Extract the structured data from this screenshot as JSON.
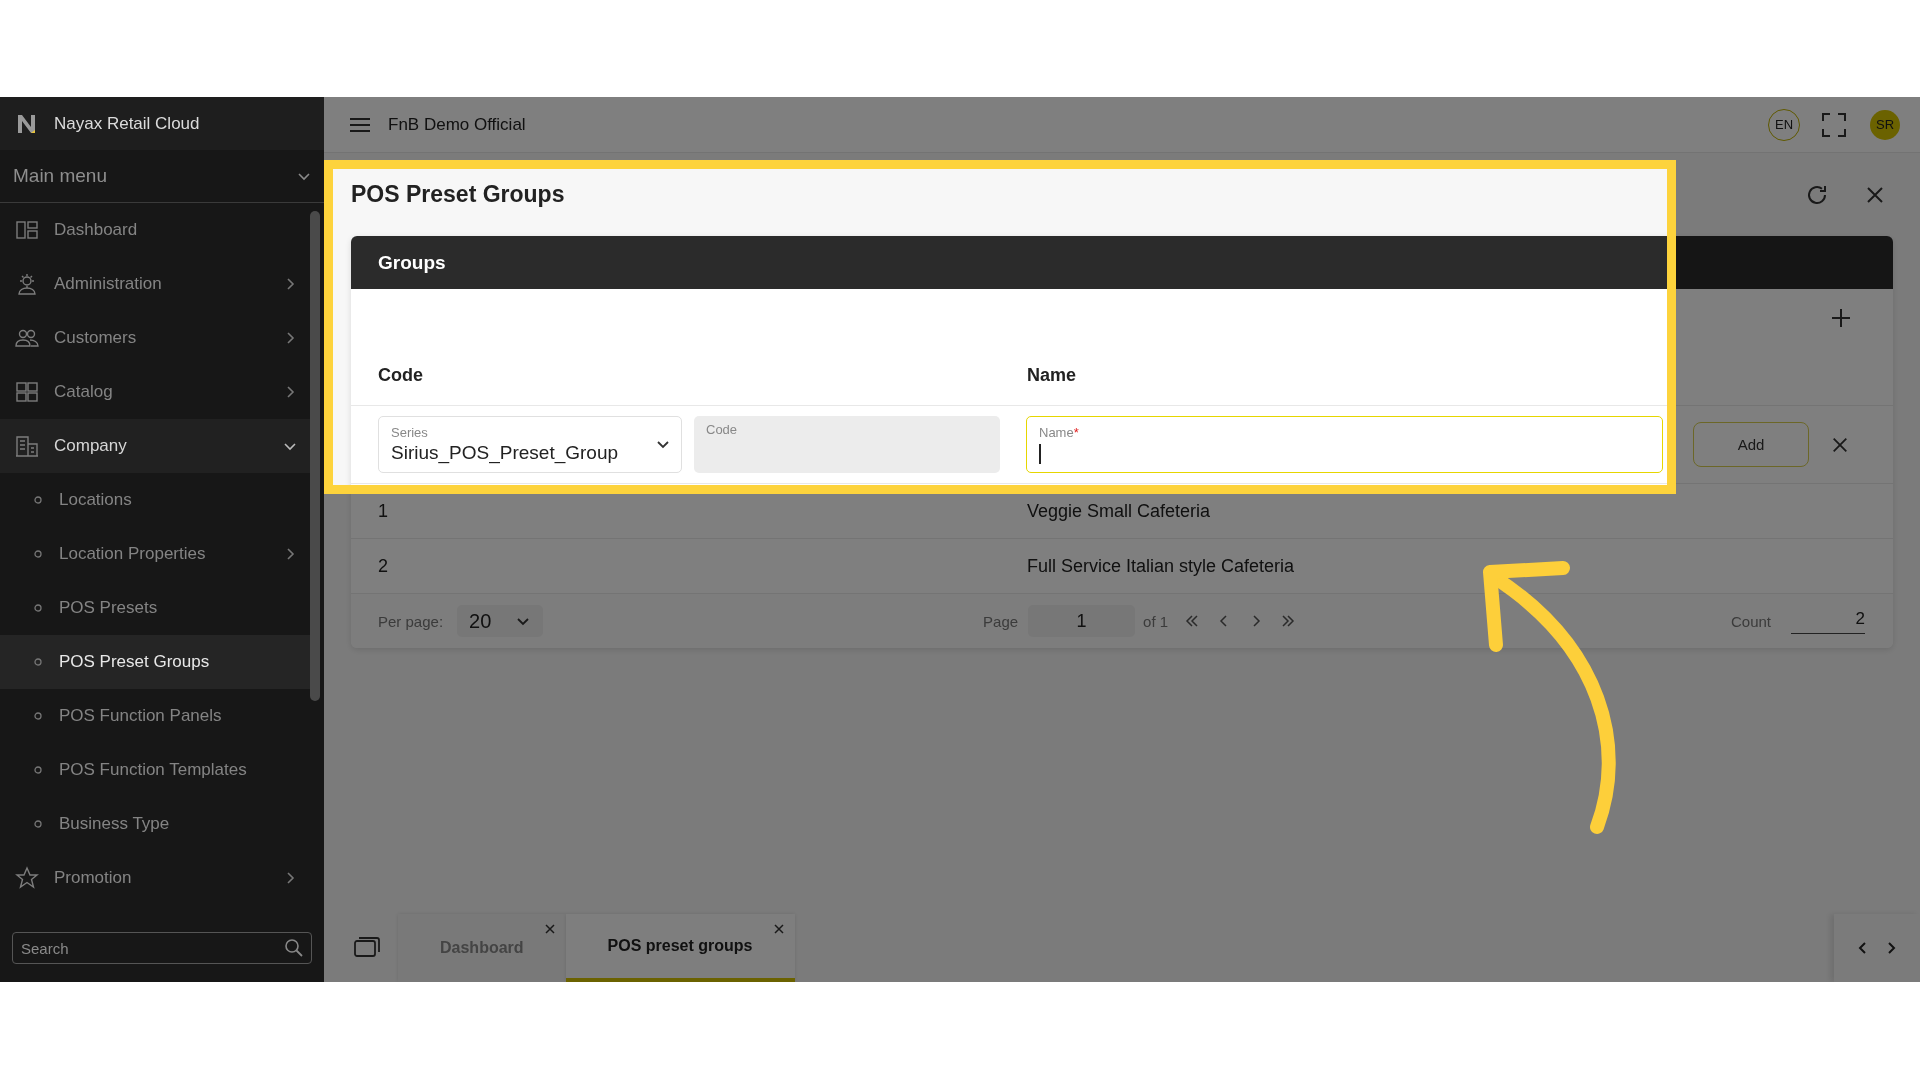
{
  "brand": {
    "name": "Nayax Retail Cloud"
  },
  "sidebar": {
    "heading": "Main menu",
    "heading_expanded": true,
    "items": [
      {
        "label": "Dashboard",
        "kind": "link",
        "selected": false
      },
      {
        "label": "Administration",
        "kind": "group",
        "expanded": false,
        "selected": false
      },
      {
        "label": "Customers",
        "kind": "group",
        "expanded": false,
        "selected": false
      },
      {
        "label": "Catalog",
        "kind": "group",
        "expanded": false,
        "selected": false
      },
      {
        "label": "Company",
        "kind": "group",
        "expanded": true,
        "selected": false,
        "children": [
          {
            "label": "Locations",
            "kind": "link",
            "selected": false
          },
          {
            "label": "Location Properties",
            "kind": "group",
            "expanded": false,
            "selected": false
          },
          {
            "label": "POS Presets",
            "kind": "link",
            "selected": false
          },
          {
            "label": "POS Preset Groups",
            "kind": "link",
            "selected": true
          },
          {
            "label": "POS Function Panels",
            "kind": "link",
            "selected": false
          },
          {
            "label": "POS Function Templates",
            "kind": "link",
            "selected": false
          },
          {
            "label": "Business Type",
            "kind": "link",
            "selected": false
          }
        ]
      },
      {
        "label": "Promotion",
        "kind": "group",
        "expanded": false,
        "selected": false
      }
    ],
    "search": {
      "placeholder": "Search"
    }
  },
  "topbar": {
    "company": "FnB Demo Official",
    "language": "EN",
    "user_initials": "SR"
  },
  "page": {
    "title": "POS Preset Groups"
  },
  "card": {
    "title": "Groups",
    "columns": [
      "Code",
      "Name"
    ],
    "new_row": {
      "series_label": "Series",
      "series_value": "Sirius_POS_Preset_Group",
      "code_label": "Code",
      "name_label": "Name",
      "name_required_mark": "*",
      "add_button": "Add"
    },
    "rows": [
      {
        "code": "1",
        "name": "Veggie Small Cafeteria"
      },
      {
        "code": "2",
        "name": "Full Service Italian style Cafeteria"
      }
    ],
    "pagination": {
      "per_page_label": "Per page:",
      "per_page": "20",
      "page_label": "Page",
      "page": "1",
      "of": "of 1",
      "count_label": "Count",
      "count": "2"
    }
  },
  "tabs": [
    {
      "label": "Dashboard",
      "selected": false
    },
    {
      "label": "POS preset groups",
      "selected": true
    }
  ]
}
